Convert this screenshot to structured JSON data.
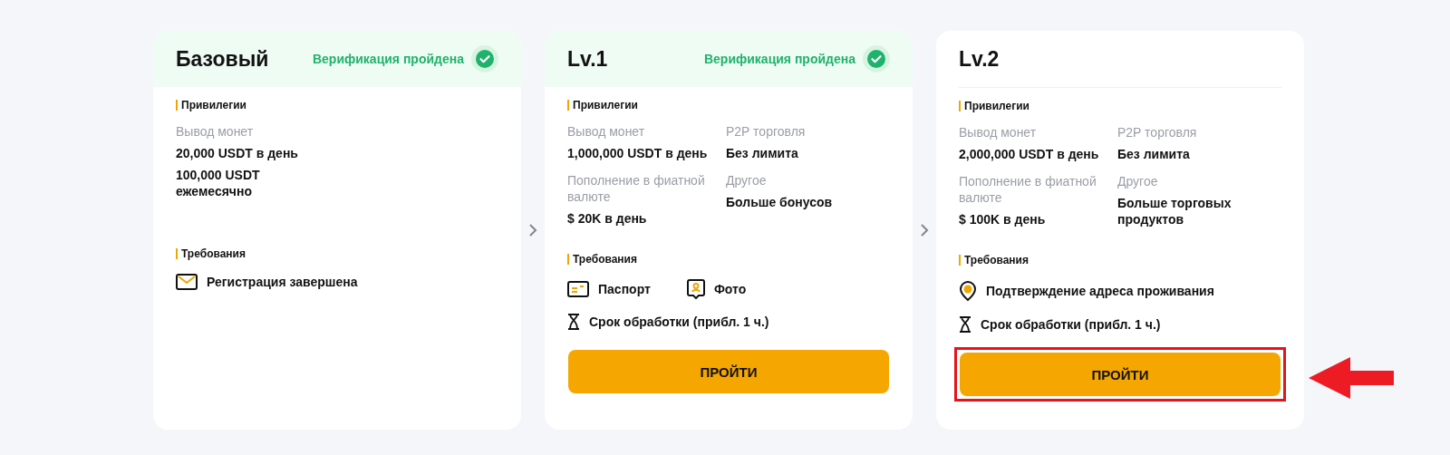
{
  "cards": [
    {
      "title": "Базовый",
      "verified": true,
      "status": "Верификация пройдена",
      "privileges_heading": "Привилегии",
      "privileges": [
        {
          "label": "Вывод монет",
          "value": [
            "20,000 USDT в день",
            "100,000 USDT ежемесячно"
          ]
        }
      ],
      "requirements_heading": "Требования",
      "requirements": [
        [
          {
            "kind": "envelope",
            "text": "Регистрация завершена"
          }
        ]
      ]
    },
    {
      "title": "Lv.1",
      "verified": true,
      "status": "Верификация пройдена",
      "privileges_heading": "Привилегии",
      "privileges": [
        {
          "label": "Вывод монет",
          "value": [
            "1,000,000 USDT в день"
          ]
        },
        {
          "label": "P2P торговля",
          "value": [
            "Без лимита"
          ]
        },
        {
          "label": "Пополнение в фиатной валюте",
          "value": [
            "$ 20K в день"
          ]
        },
        {
          "label": "Другое",
          "value": [
            "Больше бонусов"
          ]
        }
      ],
      "requirements_heading": "Требования",
      "requirements": [
        [
          {
            "kind": "idcard",
            "text": "Паспорт"
          },
          {
            "kind": "photo",
            "text": "Фото"
          }
        ],
        [
          {
            "kind": "time",
            "text": "Срок обработки (прибл. 1 ч.)"
          }
        ]
      ],
      "button": {
        "label": "ПРОЙТИ",
        "highlighted": false
      }
    },
    {
      "title": "Lv.2",
      "verified": false,
      "privileges_heading": "Привилегии",
      "privileges": [
        {
          "label": "Вывод монет",
          "value": [
            "2,000,000 USDT в день"
          ]
        },
        {
          "label": "P2P торговля",
          "value": [
            "Без лимита"
          ]
        },
        {
          "label": "Пополнение в фиатной валюте",
          "value": [
            "$ 100K в день"
          ]
        },
        {
          "label": "Другое",
          "value": [
            "Больше торговых продуктов"
          ]
        }
      ],
      "requirements_heading": "Требования",
      "requirements": [
        [
          {
            "kind": "address",
            "text": "Подтверждение адреса проживания"
          }
        ],
        [
          {
            "kind": "time",
            "text": "Срок обработки (прибл. 1 ч.)"
          }
        ]
      ],
      "button": {
        "label": "ПРОЙТИ",
        "highlighted": true
      }
    }
  ]
}
